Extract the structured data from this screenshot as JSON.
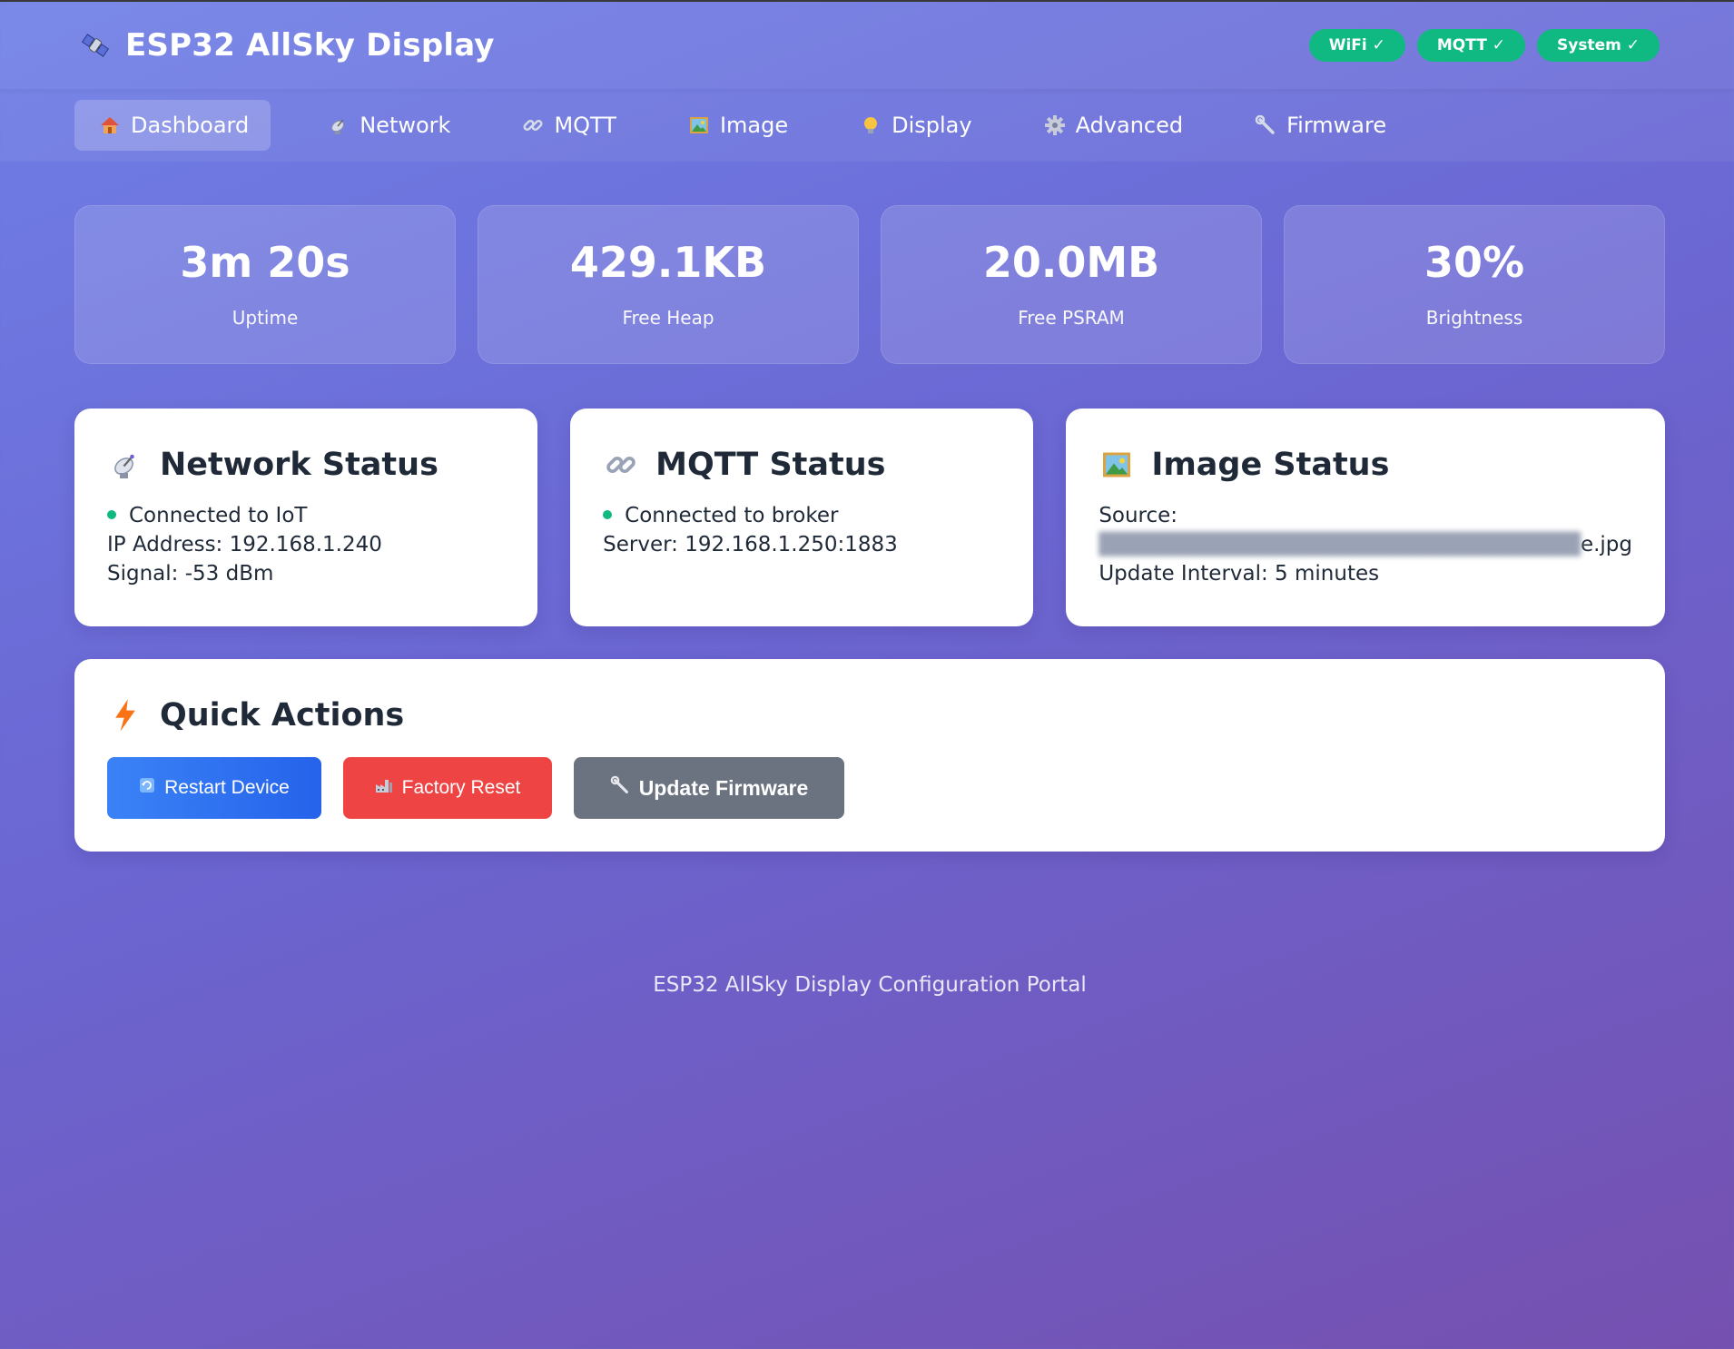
{
  "app": {
    "title": "ESP32 AllSky Display",
    "icon": "satellite-icon"
  },
  "badges": [
    {
      "label": "WiFi ✓"
    },
    {
      "label": "MQTT ✓"
    },
    {
      "label": "System ✓"
    }
  ],
  "nav": {
    "tabs": [
      {
        "label": "Dashboard",
        "icon": "house-icon",
        "active": true
      },
      {
        "label": "Network",
        "icon": "satellite-dish-icon"
      },
      {
        "label": "MQTT",
        "icon": "link-icon"
      },
      {
        "label": "Image",
        "icon": "picture-icon"
      },
      {
        "label": "Display",
        "icon": "lightbulb-icon"
      },
      {
        "label": "Advanced",
        "icon": "gear-icon"
      },
      {
        "label": "Firmware",
        "icon": "wrench-icon"
      }
    ]
  },
  "stats": [
    {
      "value": "3m 20s",
      "label": "Uptime"
    },
    {
      "value": "429.1KB",
      "label": "Free Heap"
    },
    {
      "value": "20.0MB",
      "label": "Free PSRAM"
    },
    {
      "value": "30%",
      "label": "Brightness"
    }
  ],
  "network_status": {
    "title": "Network Status",
    "connected": "Connected to IoT",
    "ip": "IP Address: 192.168.1.240",
    "signal": "Signal: -53 dBm"
  },
  "mqtt_status": {
    "title": "MQTT Status",
    "connected": "Connected to broker",
    "server": "Server: 192.168.1.250:1883"
  },
  "image_status": {
    "title": "Image Status",
    "source_label": "Source:",
    "source_value_visible": "e.jpg",
    "interval": "Update Interval: 5 minutes"
  },
  "quick_actions": {
    "title": "Quick Actions",
    "restart": "Restart Device",
    "reset": "Factory Reset",
    "update": "Update Firmware"
  },
  "footer": {
    "text": "ESP32 AllSky Display Configuration Portal"
  },
  "colors": {
    "success": "#10b981",
    "primary": "#3b82f6",
    "danger": "#ef4444",
    "neutral": "#6b7280"
  }
}
